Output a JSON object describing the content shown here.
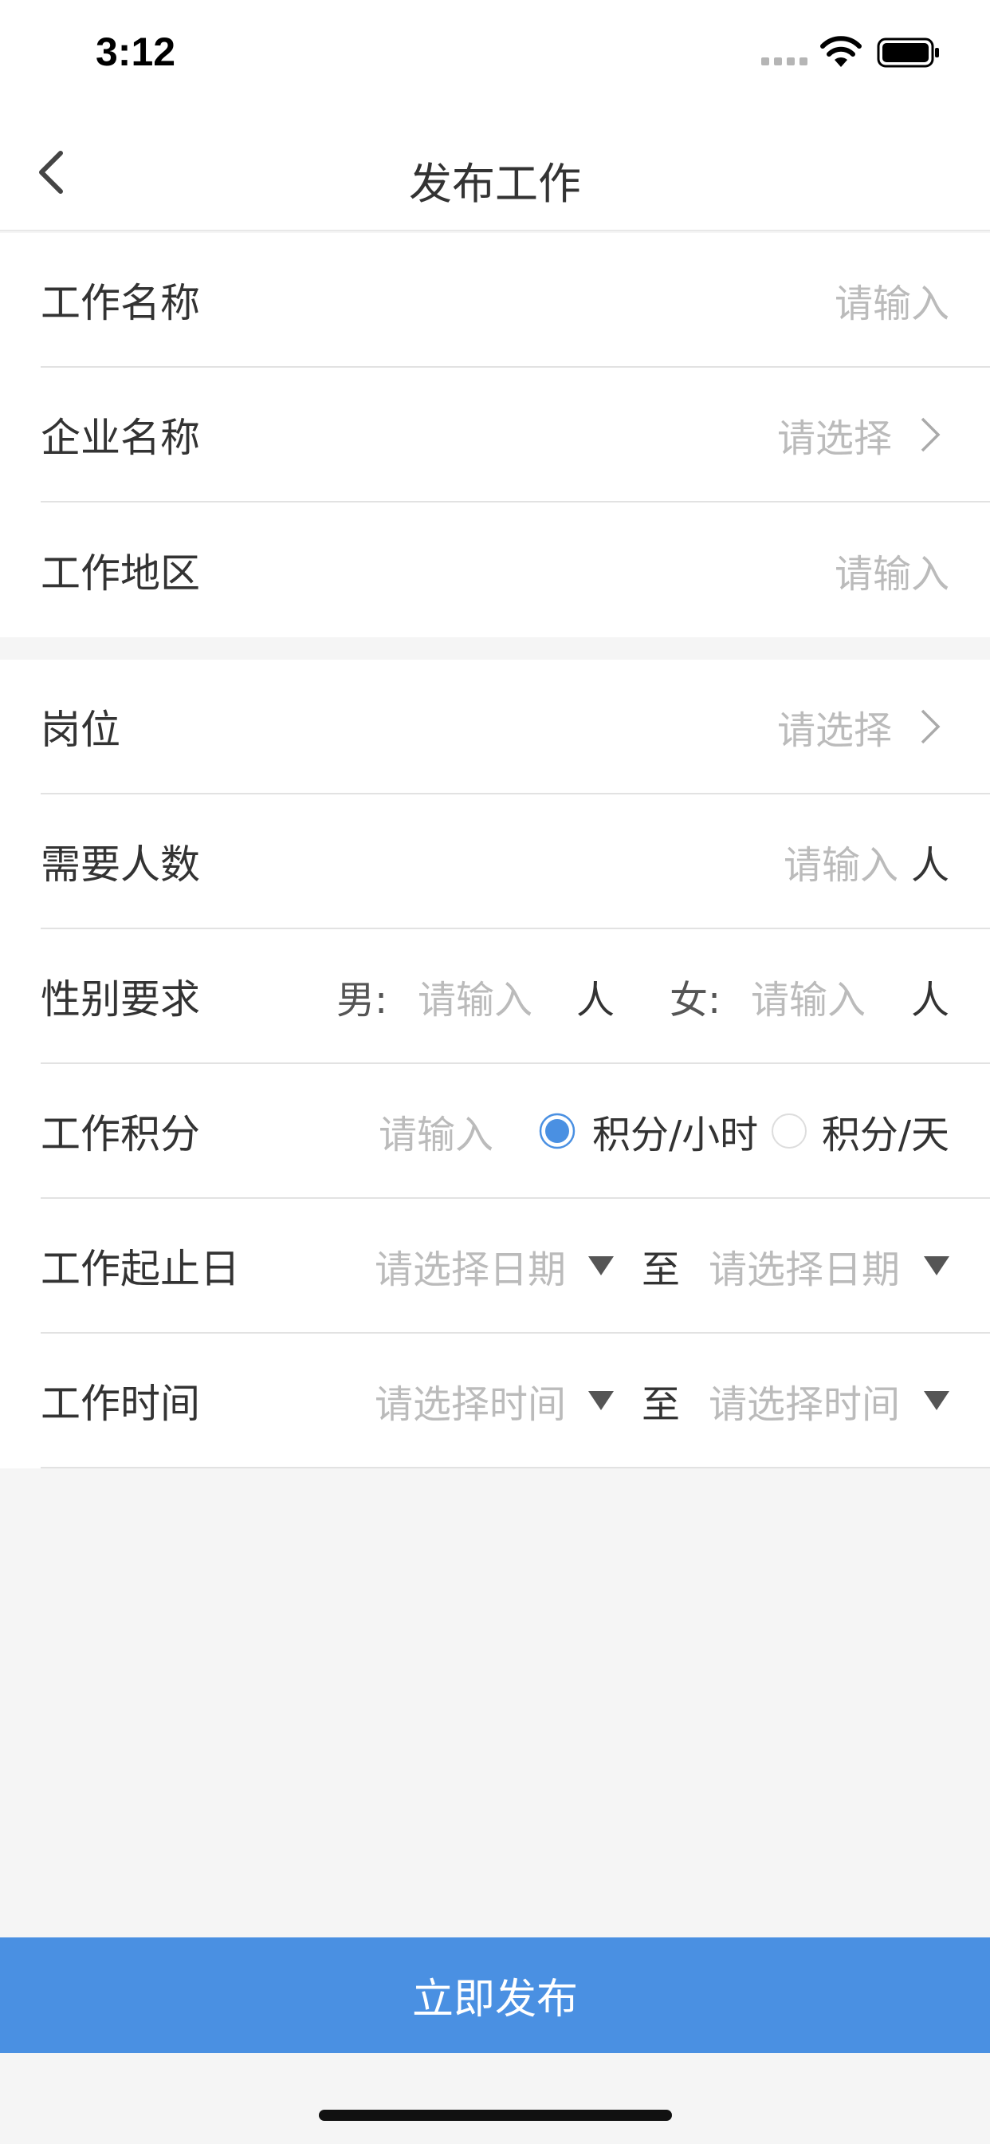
{
  "status_bar": {
    "time": "3:12"
  },
  "nav": {
    "title": "发布工作"
  },
  "section1": {
    "job_name": {
      "label": "工作名称",
      "placeholder": "请输入"
    },
    "company": {
      "label": "企业名称",
      "placeholder": "请选择"
    },
    "region": {
      "label": "工作地区",
      "placeholder": "请输入"
    }
  },
  "section2": {
    "position": {
      "label": "岗位",
      "placeholder": "请选择"
    },
    "headcount": {
      "label": "需要人数",
      "placeholder": "请输入",
      "unit": "人"
    },
    "gender": {
      "label": "性别要求",
      "male_label": "男:",
      "male_placeholder": "请输入",
      "male_unit": "人",
      "female_label": "女:",
      "female_placeholder": "请输入",
      "female_unit": "人"
    },
    "points": {
      "label": "工作积分",
      "placeholder": "请输入",
      "option_hour": "积分/小时",
      "option_day": "积分/天",
      "selected": "积分/小时"
    },
    "dates": {
      "label": "工作起止日",
      "start_placeholder": "请选择日期",
      "separator": "至",
      "end_placeholder": "请选择日期"
    },
    "time": {
      "label": "工作时间",
      "start_placeholder": "请选择时间",
      "separator": "至",
      "end_placeholder": "请选择时间"
    }
  },
  "submit": {
    "label": "立即发布"
  },
  "colors": {
    "accent": "#4a90e2",
    "placeholder": "#bbbbbb",
    "text": "#333333",
    "background": "#f5f5f5"
  }
}
